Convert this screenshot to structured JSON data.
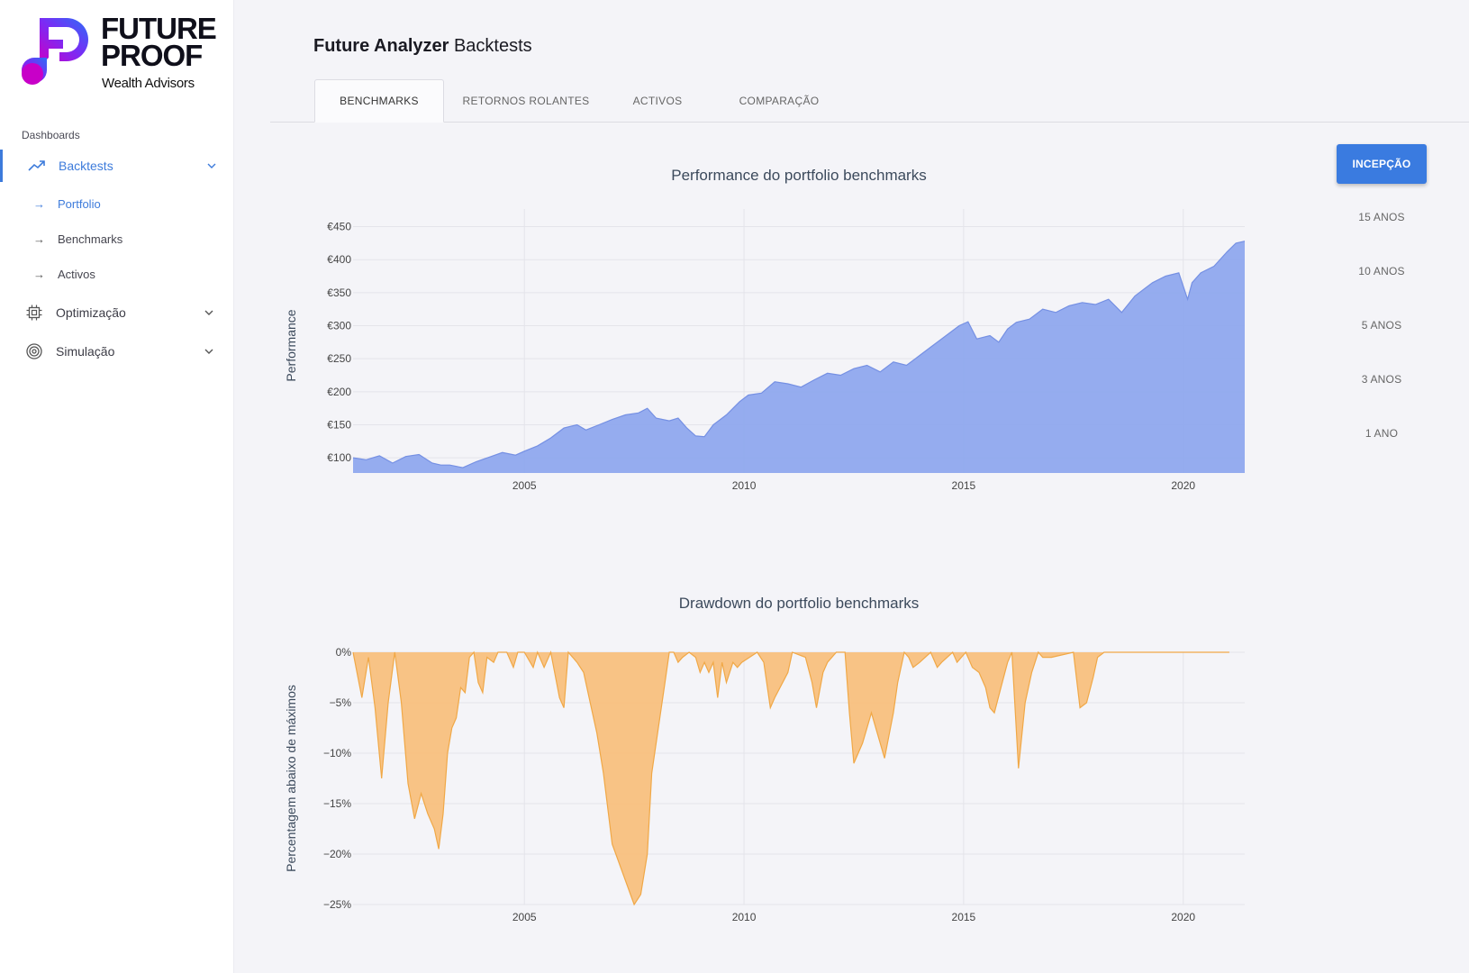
{
  "brand": {
    "line1": "FUTURE",
    "line2": "PROOF",
    "subtitle": "Wealth Advisors",
    "colors": {
      "blue": "#2f6df6",
      "purple": "#7b2ff7",
      "magenta": "#c400c4"
    }
  },
  "sidebar": {
    "section_label": "Dashboards",
    "items": [
      {
        "label": "Backtests",
        "icon": "trending-up-icon",
        "active": true,
        "expanded": true,
        "children": [
          {
            "label": "Portfolio",
            "active": true
          },
          {
            "label": "Benchmarks",
            "active": false
          },
          {
            "label": "Activos",
            "active": false
          }
        ]
      },
      {
        "label": "Optimização",
        "icon": "cpu-icon",
        "active": false,
        "expanded": false
      },
      {
        "label": "Simulação",
        "icon": "target-icon",
        "active": false,
        "expanded": false
      }
    ]
  },
  "page": {
    "title_bold": "Future Analyzer",
    "title_rest": " Backtests"
  },
  "tabs": [
    {
      "label": "BENCHMARKS",
      "active": true
    },
    {
      "label": "RETORNOS ROLANTES",
      "active": false
    },
    {
      "label": "ACTIVOS",
      "active": false
    },
    {
      "label": "COMPARAÇÃO",
      "active": false
    }
  ],
  "periods": [
    {
      "label": "INCEPÇÃO",
      "active": true
    },
    {
      "label": "15 ANOS",
      "active": false
    },
    {
      "label": "10 ANOS",
      "active": false
    },
    {
      "label": "5 ANOS",
      "active": false
    },
    {
      "label": "3 ANOS",
      "active": false
    },
    {
      "label": "1 ANO",
      "active": false
    }
  ],
  "chart_data": [
    {
      "type": "area",
      "title": "Performance do portfolio benchmarks",
      "xlabel": "",
      "ylabel": "Performance",
      "fill_color": "#8fa8ee",
      "line_color": "#7590e3",
      "xlim": [
        2001.1,
        2021.4
      ],
      "ylim": [
        77,
        463
      ],
      "yticks": [
        100,
        150,
        200,
        250,
        300,
        350,
        400,
        450
      ],
      "ytick_labels": [
        "€100",
        "€150",
        "€200",
        "€250",
        "€300",
        "€350",
        "€400",
        "€450"
      ],
      "xticks": [
        2005,
        2010,
        2015,
        2020
      ],
      "grid": true,
      "x": [
        2001.1,
        2001.4,
        2001.7,
        2002.0,
        2002.3,
        2002.6,
        2002.9,
        2003.1,
        2003.3,
        2003.6,
        2003.9,
        2004.2,
        2004.5,
        2004.8,
        2005.0,
        2005.3,
        2005.6,
        2005.9,
        2006.2,
        2006.4,
        2006.7,
        2007.0,
        2007.3,
        2007.6,
        2007.8,
        2008.0,
        2008.3,
        2008.5,
        2008.7,
        2008.9,
        2009.1,
        2009.3,
        2009.6,
        2009.9,
        2010.1,
        2010.4,
        2010.7,
        2011.0,
        2011.3,
        2011.6,
        2011.9,
        2012.2,
        2012.5,
        2012.8,
        2013.1,
        2013.4,
        2013.7,
        2014.0,
        2014.3,
        2014.6,
        2014.9,
        2015.1,
        2015.3,
        2015.6,
        2015.8,
        2016.0,
        2016.2,
        2016.5,
        2016.8,
        2017.1,
        2017.4,
        2017.7,
        2018.0,
        2018.3,
        2018.6,
        2018.9,
        2019.0,
        2019.3,
        2019.6,
        2019.9,
        2020.1,
        2020.2,
        2020.4,
        2020.7,
        2021.0,
        2021.2,
        2021.4
      ],
      "y": [
        100,
        97,
        103,
        92,
        102,
        105,
        92,
        89,
        89,
        85,
        94,
        101,
        108,
        104,
        110,
        118,
        130,
        145,
        150,
        142,
        150,
        158,
        165,
        168,
        175,
        160,
        156,
        160,
        145,
        133,
        132,
        150,
        165,
        185,
        195,
        198,
        215,
        212,
        207,
        218,
        228,
        225,
        235,
        240,
        230,
        245,
        240,
        255,
        270,
        285,
        300,
        306,
        280,
        285,
        275,
        295,
        305,
        310,
        325,
        320,
        330,
        335,
        332,
        340,
        320,
        345,
        350,
        365,
        375,
        380,
        340,
        365,
        380,
        390,
        412,
        425,
        428
      ]
    },
    {
      "type": "area",
      "title": "Drawdown do portfolio benchmarks",
      "xlabel": "",
      "ylabel": "Percentagem abaixo de máximos",
      "fill_color": "#f8c07e",
      "line_color": "#f0a847",
      "xlim": [
        2001.1,
        2021.4
      ],
      "ylim": [
        -25,
        0
      ],
      "yticks": [
        0,
        -5,
        -10,
        -15,
        -20,
        -25
      ],
      "ytick_labels": [
        "0%",
        "−5%",
        "−10%",
        "−15%",
        "−20%",
        "−25%"
      ],
      "xticks": [
        2005,
        2010,
        2015,
        2020
      ],
      "grid": true,
      "x": [
        2001.1,
        2001.3,
        2001.45,
        2001.6,
        2001.75,
        2001.9,
        2002.05,
        2002.2,
        2002.35,
        2002.5,
        2002.65,
        2002.8,
        2002.95,
        2003.05,
        2003.15,
        2003.25,
        2003.35,
        2003.45,
        2003.55,
        2003.65,
        2003.75,
        2003.85,
        2003.95,
        2004.05,
        2004.15,
        2004.3,
        2004.4,
        2004.5,
        2004.6,
        2004.75,
        2004.85,
        2005.0,
        2005.2,
        2005.3,
        2005.45,
        2005.6,
        2005.8,
        2005.9,
        2006.0,
        2006.2,
        2006.35,
        2006.5,
        2006.65,
        2006.8,
        2007.0,
        2007.5,
        2007.65,
        2007.8,
        2007.9,
        2008.1,
        2008.2,
        2008.3,
        2008.4,
        2008.5,
        2008.6,
        2008.75,
        2008.9,
        2009.0,
        2009.1,
        2009.2,
        2009.3,
        2009.4,
        2009.5,
        2009.6,
        2009.75,
        2009.85,
        2009.95,
        2010.3,
        2010.45,
        2010.6,
        2010.7,
        2011.0,
        2011.1,
        2011.4,
        2011.55,
        2011.65,
        2011.8,
        2011.9,
        2012.1,
        2012.3,
        2012.4,
        2012.5,
        2012.7,
        2012.9,
        2013.2,
        2013.4,
        2013.5,
        2013.65,
        2013.75,
        2013.85,
        2014.0,
        2014.25,
        2014.4,
        2014.5,
        2014.75,
        2014.85,
        2015.05,
        2015.2,
        2015.35,
        2015.5,
        2015.6,
        2015.7,
        2015.85,
        2016.0,
        2016.1,
        2016.25,
        2016.4,
        2016.55,
        2016.7,
        2016.8,
        2017.0,
        2017.5,
        2017.65,
        2017.8,
        2017.95,
        2018.05,
        2018.2,
        2018.3,
        2018.5,
        2018.6,
        2018.75,
        2018.85,
        2019.05,
        2019.15,
        2019.3,
        2019.45,
        2019.5,
        2019.55,
        2019.8,
        2020.05,
        2020.15,
        2020.25,
        2020.35,
        2020.45,
        2020.6,
        2020.8,
        2020.95,
        2021.05,
        2021.4
      ],
      "y": [
        0,
        -4.5,
        -0.5,
        -5.5,
        -12.5,
        -5,
        0,
        -5,
        -13,
        -16.5,
        -14,
        -16,
        -17.5,
        -19.5,
        -16,
        -10,
        -7.5,
        -6.5,
        -3.5,
        -4,
        -0.5,
        0,
        -3,
        -4,
        -0.5,
        -1,
        0,
        0,
        0,
        -1.5,
        0,
        0,
        -1.5,
        0,
        -1.5,
        0,
        -4.5,
        -5.5,
        0,
        -1,
        -2,
        -5,
        -8,
        -12,
        -19,
        -25,
        -24,
        -20,
        -12,
        -6,
        -3,
        0,
        0,
        -1,
        -0.5,
        0,
        -0.5,
        -2,
        -1,
        -2,
        -1,
        -4.5,
        -1,
        -3,
        -1,
        -1.5,
        -1,
        0,
        -1,
        -5.5,
        -4.5,
        -2,
        0,
        -0.5,
        -3,
        -5.5,
        -2,
        -1,
        0,
        0,
        -6,
        -11,
        -9,
        -6,
        -10.5,
        -6,
        -3,
        0,
        -0.5,
        -1.5,
        -1,
        0,
        -1.5,
        -1,
        0,
        -1,
        0,
        -1.5,
        -2,
        -3.5,
        -5.5,
        -6,
        -3.5,
        -1,
        0,
        -11.5,
        -5,
        -2,
        0,
        -0.5,
        -0.5,
        0,
        -5.5,
        -5,
        -2.5,
        -0.5,
        0,
        0,
        0,
        0,
        0,
        0,
        0,
        0,
        0,
        0,
        0,
        0,
        0,
        0,
        0,
        0,
        0,
        0,
        0,
        0,
        0,
        0
      ]
    }
  ]
}
